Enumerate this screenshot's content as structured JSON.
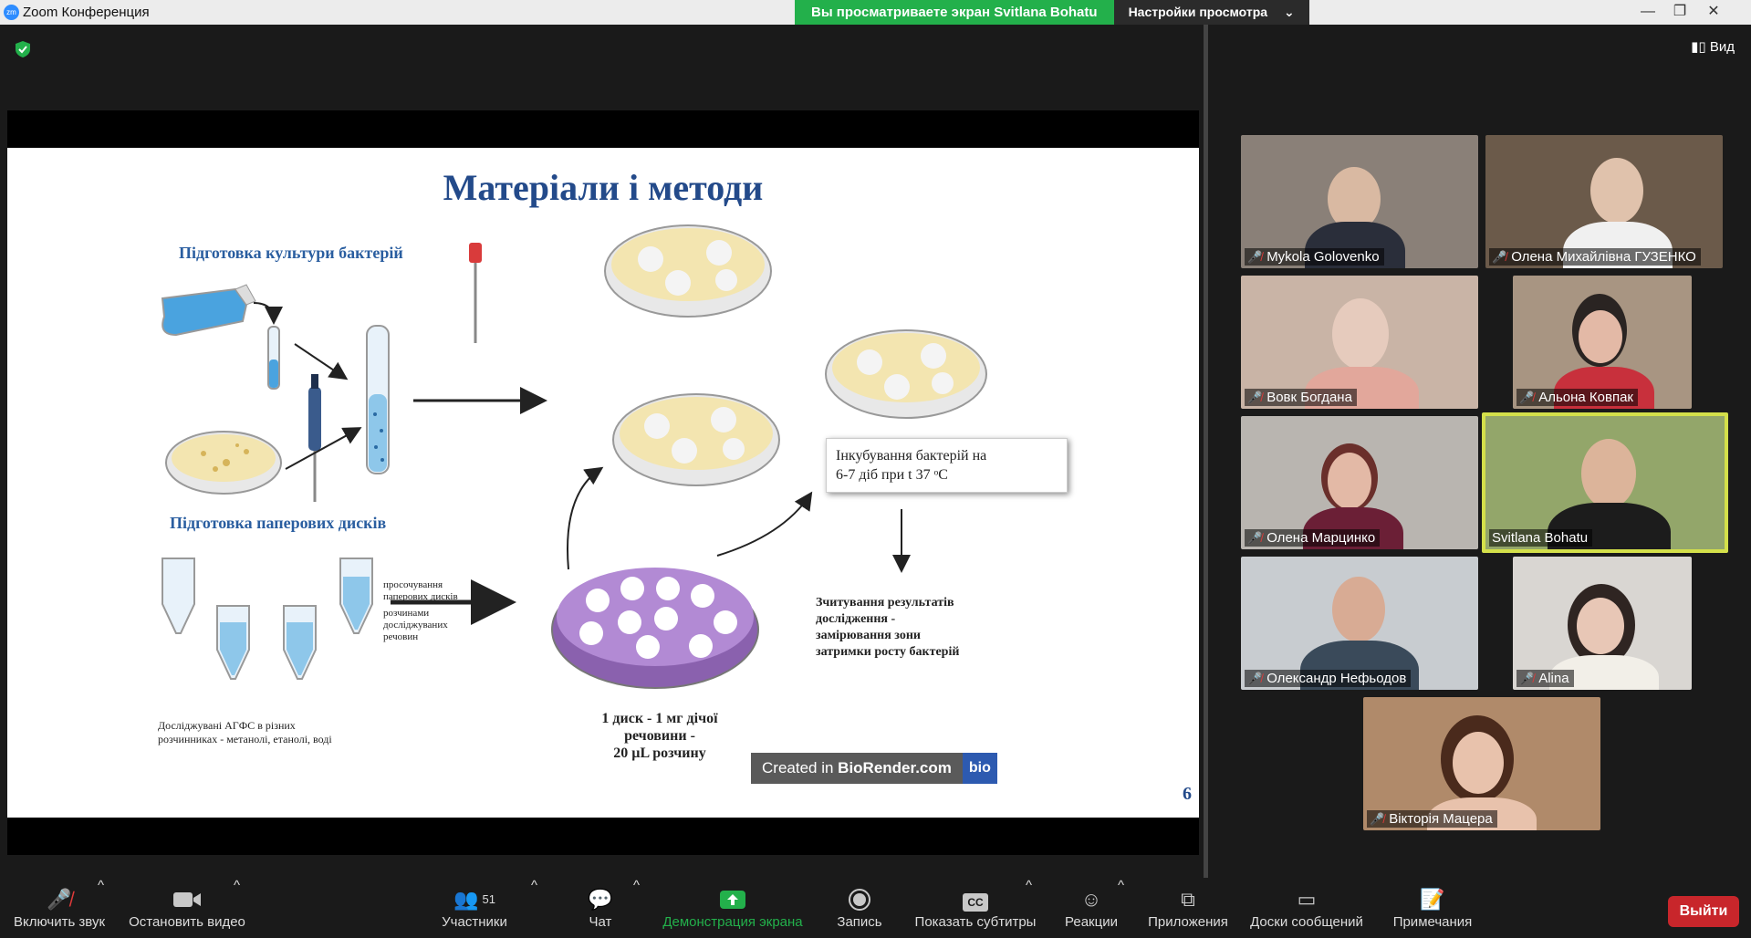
{
  "window": {
    "title": "Zoom Конференция",
    "logo": "zm"
  },
  "share_bar": {
    "notice": "Вы просматриваете экран Svitlana Bohatu",
    "view_settings": "Настройки просмотра",
    "chevron": "⌄"
  },
  "window_controls": {
    "minimize": "—",
    "maximize": "❐",
    "close": "✕"
  },
  "top_right": {
    "view_label": "Вид",
    "view_icon": "▮▯"
  },
  "slide": {
    "title": "Матеріали і методи",
    "culture_label": "Підготовка культури бактерій",
    "disks_label": "Підготовка паперових дисків",
    "soak_text": [
      "просочування",
      "паперових дисків",
      "розчинами",
      "досліджуваних",
      "речовин"
    ],
    "agfs_text": [
      "Досліджувані АГФС в різних",
      "розчинниках - метанолі, етанолі, воді"
    ],
    "dose_text": [
      "1 диск - 1 мг дічої",
      "речовини -",
      "20 µL розчину"
    ],
    "incubation_text": [
      "Інкубування бактерій на",
      "6-7 діб при t 37 ᵒC"
    ],
    "reading_text": [
      "Зчитування результатів",
      "дослідження -",
      "замірювання зони",
      "затримки росту бактерій"
    ],
    "biorender_prefix": "Created in ",
    "biorender_brand": "BioRender.com",
    "biorender_badge": "bio",
    "page_number": "6"
  },
  "participants_tiles": [
    {
      "name": "Mykola Golovenko",
      "bg": "#8a8078"
    },
    {
      "name": "Олена Михайлівна ГУЗЕНКО",
      "bg": "#6b5a4a"
    },
    {
      "name": "Вовк Богдана",
      "bg": "#c9b4a6"
    },
    {
      "name": "Альона Ковпак",
      "bg": "#a89582"
    },
    {
      "name": "Олена Марцинко",
      "bg": "#b9b5b0"
    },
    {
      "name": "Svitlana Bohatu",
      "bg": "#93a66a",
      "active": true
    },
    {
      "name": "Олександр  Нефьодов",
      "bg": "#c8ccd0"
    },
    {
      "name": "Alina",
      "bg": "#d9d6d2"
    },
    {
      "name": "Вікторія Мацера",
      "bg": "#b08a6a"
    }
  ],
  "toolbar": {
    "mute_label": "Включить звук",
    "video_label": "Остановить видео",
    "participants_label": "Участники",
    "participants_count": "51",
    "chat_label": "Чат",
    "share_label": "Демонстрация экрана",
    "record_label": "Запись",
    "captions_label": "Показать субтитры",
    "captions_icon": "CC",
    "reactions_label": "Реакции",
    "apps_label": "Приложения",
    "whiteboards_label": "Доски сообщений",
    "notes_label": "Примечания",
    "leave_label": "Выйти",
    "caret": "^"
  },
  "colors": {
    "share_green": "#23b04b",
    "leave_red": "#c8262b",
    "active_speaker": "#d4e04a",
    "slide_title": "#234a8a",
    "section_label": "#2a5ea0"
  }
}
